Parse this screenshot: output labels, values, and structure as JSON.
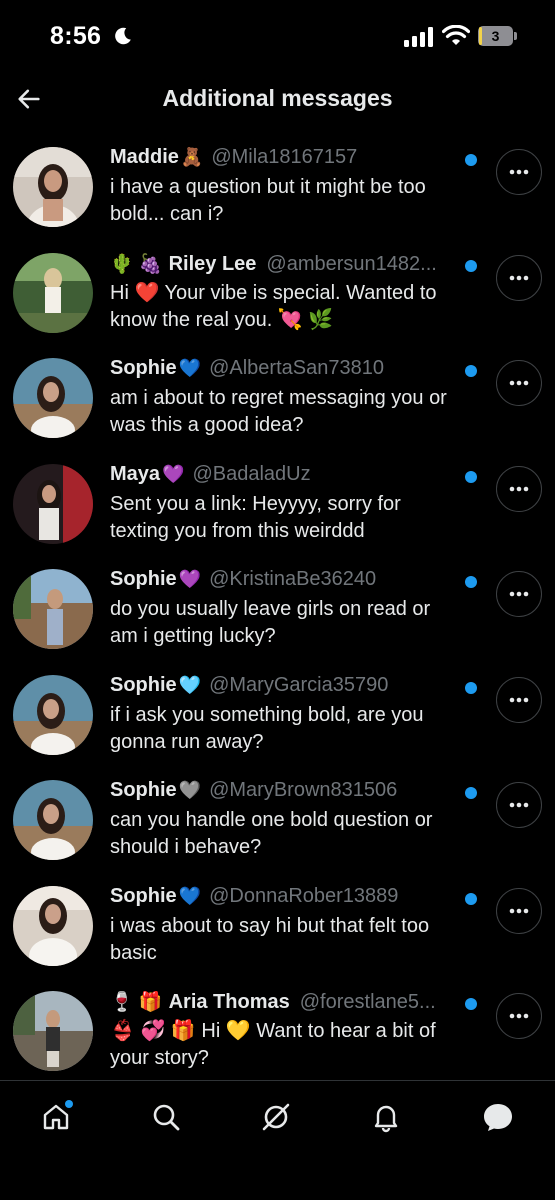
{
  "status_bar": {
    "time": "8:56",
    "battery_level": "3",
    "battery_fraction": 0.03,
    "icons": [
      "moon-icon",
      "signal-icon",
      "wifi-icon",
      "battery-icon"
    ]
  },
  "header": {
    "title": "Additional messages",
    "back_icon": "arrow-left-icon"
  },
  "colors": {
    "background": "#000000",
    "text_primary": "#e7e9ea",
    "text_secondary": "#71767b",
    "accent_blue": "#1d9bf0",
    "battery_yellow": "#f2d34a"
  },
  "messages": [
    {
      "emoji_prefix": "",
      "name": "Maddie",
      "name_emoji": "🧸",
      "handle": "@Mila18167157",
      "preview": "i have a question but it might be too bold... can i?",
      "unread": true
    },
    {
      "emoji_prefix": "🌵 🍇",
      "name": "Riley Lee",
      "name_emoji": "",
      "handle": "@ambersun1482...",
      "preview": "Hi ❤️ Your vibe is special. Wanted to know the real you. 💘 🌿",
      "unread": true
    },
    {
      "emoji_prefix": "",
      "name": "Sophie",
      "name_emoji": "💙",
      "handle": "@AlbertaSan73810",
      "preview": "am i about to regret messaging you or was this a good idea?",
      "unread": true
    },
    {
      "emoji_prefix": "",
      "name": "Maya",
      "name_emoji": "💜",
      "handle": "@BadaladUz",
      "preview": "Sent you a link: Heyyyy, sorry for texting you from this weirddd",
      "unread": true
    },
    {
      "emoji_prefix": "",
      "name": "Sophie",
      "name_emoji": "💜",
      "handle": "@KristinaBe36240",
      "preview": "do you usually leave girls on read or am i getting lucky?",
      "unread": true
    },
    {
      "emoji_prefix": "",
      "name": "Sophie",
      "name_emoji": "🩵",
      "handle": "@MaryGarcia35790",
      "preview": "if i ask you something bold, are you gonna run away?",
      "unread": true
    },
    {
      "emoji_prefix": "",
      "name": "Sophie",
      "name_emoji": "🩶",
      "handle": "@MaryBrown831506",
      "preview": "can you handle one bold question or should i behave?",
      "unread": true
    },
    {
      "emoji_prefix": "",
      "name": "Sophie",
      "name_emoji": "💙",
      "handle": "@DonnaRober13889",
      "preview": "i was about to say hi but that felt too basic",
      "unread": true
    },
    {
      "emoji_prefix": "🍷 🎁",
      "name": "Aria Thomas",
      "name_emoji": "",
      "handle": "@forestlane5...",
      "preview": "👙 💞 🎁 Hi 💛 Want to hear a bit of your story?",
      "unread": true
    }
  ],
  "bottom_nav": [
    {
      "icon": "home-icon",
      "active": true,
      "badge": true
    },
    {
      "icon": "search-icon",
      "active": false,
      "badge": false
    },
    {
      "icon": "grok-icon",
      "active": false,
      "badge": false
    },
    {
      "icon": "bell-icon",
      "active": false,
      "badge": false
    },
    {
      "icon": "messages-icon",
      "active": true,
      "badge": false
    }
  ]
}
